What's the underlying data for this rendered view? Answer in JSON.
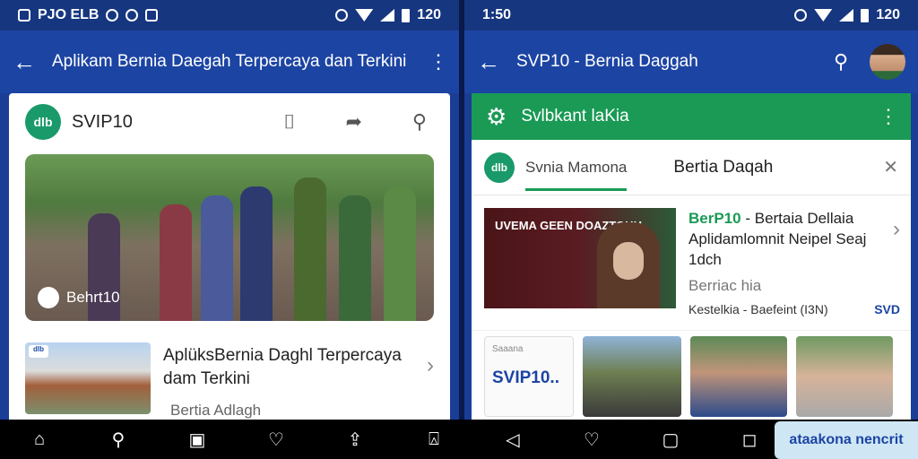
{
  "left": {
    "status": {
      "left_text": "PJO ELB",
      "right_text": "120"
    },
    "appbar": {
      "title": "Aplikam Bernia Daegah Terpercaya dan Terkini"
    },
    "card": {
      "brand": "SVIP10",
      "logo_text": "dlb",
      "hero_label": "Behrt10",
      "item_title": "AplüksBernia Daghl Terpercaya dam Terkini",
      "item_subtitle": "Bertia Adlagh"
    }
  },
  "right": {
    "status": {
      "time": "1:50",
      "right_text": "120"
    },
    "appbar": {
      "title": "SVP10 - Bernia Daggah"
    },
    "green_bar": {
      "title": "Svlbkant laKia"
    },
    "tabs": {
      "logo_text": "dlb",
      "tab1": "Svnia Mamona",
      "tab2": "Bertia Daqah"
    },
    "feature": {
      "image_text": "UVEMA GEEN DOAZTOHH",
      "title_hl": "BerP10",
      "title_rest": "- Bertaia Dellaia Aplidamlomnit Neipel Seaj 1dch",
      "subtitle": "Berriac hia",
      "meta": "Kestelkia - Baefeint (I3N)",
      "tag": "SVD"
    },
    "thumbs": {
      "tile1_small": "Saaana",
      "tile1_big": "SVIP10.."
    }
  },
  "navbar": {
    "pill_text": "ataakona nencrit"
  }
}
